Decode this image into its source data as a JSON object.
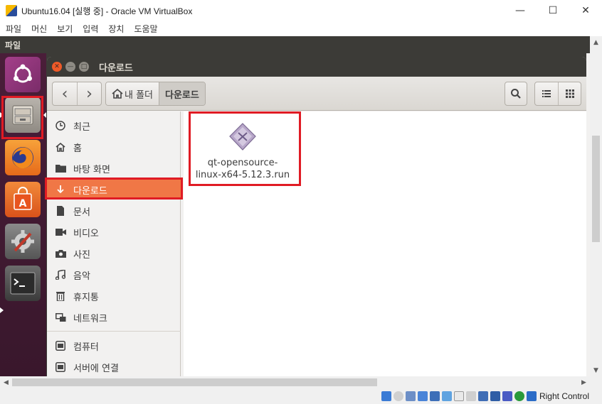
{
  "host": {
    "title": "Ubuntu16.04 [실행 중] - Oracle VM VirtualBox",
    "controls": {
      "minimize": "—",
      "maximize": "☐",
      "close": "✕"
    },
    "menu": [
      "파일",
      "머신",
      "보기",
      "입력",
      "장치",
      "도움말"
    ],
    "status_right": "Right Control"
  },
  "guest": {
    "topbar_title": "파일",
    "launcher": [
      "ubuntu-dash-icon",
      "files-icon",
      "firefox-icon",
      "software-center-icon",
      "system-settings-icon",
      "terminal-icon"
    ]
  },
  "window": {
    "title": "다운로드",
    "buttons": {
      "close": "✕",
      "minimize": "—",
      "maximize": "□"
    },
    "toolbar": {
      "back": "‹",
      "forward": "›",
      "path": {
        "home_label": "내 폴더",
        "current": "다운로드"
      },
      "search": "search-icon",
      "list_view": "list-icon",
      "grid_view": "grid-icon"
    },
    "sidebar": [
      {
        "label": "최근",
        "icon": "clock-icon"
      },
      {
        "label": "홈",
        "icon": "home-icon"
      },
      {
        "label": "바탕 화면",
        "icon": "folder-icon"
      },
      {
        "label": "다운로드",
        "icon": "download-icon",
        "selected": true
      },
      {
        "label": "문서",
        "icon": "document-icon"
      },
      {
        "label": "비디오",
        "icon": "video-icon"
      },
      {
        "label": "사진",
        "icon": "camera-icon"
      },
      {
        "label": "음악",
        "icon": "music-icon"
      },
      {
        "label": "휴지통",
        "icon": "trash-icon"
      },
      {
        "label": "네트워크",
        "icon": "network-icon"
      },
      {
        "label": "컴퓨터",
        "icon": "computer-icon"
      },
      {
        "label": "서버에 연결",
        "icon": "server-icon"
      }
    ],
    "files": [
      {
        "name_line1": "qt-opensource-",
        "name_line2": "linux-x64-5.12.3.run",
        "icon": "executable-icon"
      }
    ]
  },
  "colors": {
    "selected": "#f07746",
    "highlight_box": "#e01b24",
    "launcher_bg": "#42192f",
    "titlebar": "#3c3b37"
  }
}
